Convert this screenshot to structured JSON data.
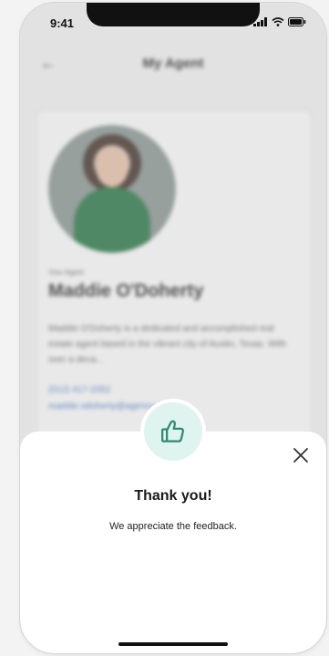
{
  "status_bar": {
    "time": "9:41",
    "icons": [
      "signal-icon",
      "wifi-icon",
      "battery-icon"
    ]
  },
  "background": {
    "header_title": "My Agent",
    "back_icon": "arrow-left-icon",
    "agent": {
      "role": "Your Agent",
      "name": "Maddie O'Doherty",
      "bio": "Maddie O'Doherty is a dedicated and accomplished real estate agent based in the vibrant city of Austin, Texas. With over a deca...",
      "phone": "(512) 417-2052",
      "email": "maddie.odoherty@agency.com"
    }
  },
  "feedback_sheet": {
    "badge_icon": "thumbs-up-icon",
    "close_icon": "close-icon",
    "title": "Thank you!",
    "message": "We appreciate the feedback."
  },
  "colors": {
    "accent": "#2e8b72",
    "badge_bg": "#dff3ef",
    "sheet_bg": "#ffffff",
    "overlay_bg": "#e2e2e2"
  }
}
